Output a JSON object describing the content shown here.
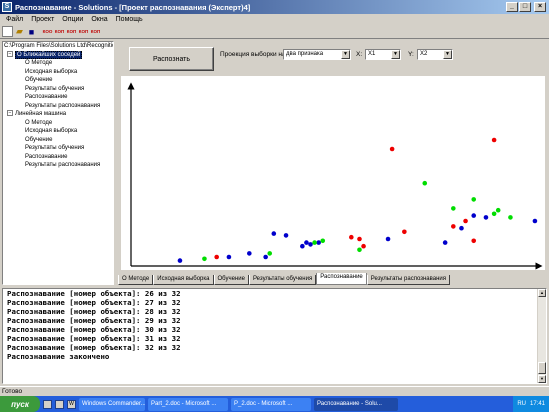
{
  "window": {
    "title": "Распознавание - Solutions - [Проект распознавания (Эксперт)4]"
  },
  "menu": [
    "Файл",
    "Проект",
    "Опции",
    "Окна",
    "Помощь"
  ],
  "toolbar": {
    "labels": [
      "КОО",
      "КОП",
      "КОП",
      "КОП",
      "КОП"
    ]
  },
  "tree": {
    "rows": [
      {
        "label": "C:\\Program Files\\Solutions Ltd\\Recognitior",
        "level": 0,
        "box": ""
      },
      {
        "label": "О Ближайших соседей",
        "level": 1,
        "box": "−",
        "selected": true
      },
      {
        "label": "О Методе",
        "level": 2,
        "box": ""
      },
      {
        "label": "Исходная выборка",
        "level": 2,
        "box": ""
      },
      {
        "label": "Обучение",
        "level": 2,
        "box": ""
      },
      {
        "label": "Результаты обучения",
        "level": 2,
        "box": ""
      },
      {
        "label": "Распознавание",
        "level": 2,
        "box": ""
      },
      {
        "label": "Результаты распознавания",
        "level": 2,
        "box": ""
      },
      {
        "label": "Линейная машина",
        "level": 1,
        "box": "−"
      },
      {
        "label": "О Методе",
        "level": 2,
        "box": ""
      },
      {
        "label": "Исходная выборка",
        "level": 2,
        "box": ""
      },
      {
        "label": "Обучение",
        "level": 2,
        "box": ""
      },
      {
        "label": "Результаты обучения",
        "level": 2,
        "box": ""
      },
      {
        "label": "Распознавание",
        "level": 2,
        "box": ""
      },
      {
        "label": "Результаты распознавания",
        "level": 2,
        "box": ""
      }
    ]
  },
  "panel": {
    "recognize_button": "Распознать",
    "projection_label": "Проекция выборки на:",
    "projection_value": "два признака",
    "x_label": "X:",
    "x_value": "X1",
    "y_label": "Y:",
    "y_value": "X2"
  },
  "chart_data": {
    "type": "scatter",
    "title": "",
    "xlabel": "",
    "ylabel": "",
    "xlim": [
      0,
      100
    ],
    "ylim": [
      0,
      100
    ],
    "grid": false,
    "series": [
      {
        "color": "#0000cc",
        "points": [
          [
            12,
            3
          ],
          [
            24,
            5
          ],
          [
            29,
            7
          ],
          [
            33,
            5
          ],
          [
            35,
            18
          ],
          [
            38,
            17
          ],
          [
            42,
            11
          ],
          [
            43,
            13
          ],
          [
            44,
            12
          ],
          [
            46,
            13
          ],
          [
            63,
            15
          ],
          [
            77,
            13
          ],
          [
            81,
            21
          ],
          [
            84,
            28
          ],
          [
            87,
            27
          ],
          [
            99,
            25
          ]
        ]
      },
      {
        "color": "#ee0000",
        "points": [
          [
            21,
            5
          ],
          [
            54,
            16
          ],
          [
            56,
            15
          ],
          [
            57,
            11
          ],
          [
            64,
            65
          ],
          [
            67,
            19
          ],
          [
            79,
            22
          ],
          [
            82,
            25
          ],
          [
            84,
            14
          ],
          [
            89,
            70
          ]
        ]
      },
      {
        "color": "#00dd00",
        "points": [
          [
            18,
            4
          ],
          [
            34,
            7
          ],
          [
            45,
            13
          ],
          [
            47,
            14
          ],
          [
            56,
            9
          ],
          [
            72,
            46
          ],
          [
            79,
            32
          ],
          [
            84,
            37
          ],
          [
            89,
            29
          ],
          [
            90,
            31
          ],
          [
            93,
            27
          ]
        ]
      }
    ]
  },
  "tabs": [
    {
      "label": "О Методе",
      "active": false
    },
    {
      "label": "Исходная выборка",
      "active": false
    },
    {
      "label": "Обучение",
      "active": false
    },
    {
      "label": "Результаты обучения",
      "active": false
    },
    {
      "label": "Распознавание",
      "active": true
    },
    {
      "label": "Результаты распознавания",
      "active": false
    }
  ],
  "log": [
    "Распознавание [номер объекта]: 26 из 32",
    "Распознавание [номер объекта]: 27 из 32",
    "Распознавание [номер объекта]: 28 из 32",
    "Распознавание [номер объекта]: 29 из 32",
    "Распознавание [номер объекта]: 30 из 32",
    "Распознавание [номер объекта]: 31 из 32",
    "Распознавание [номер объекта]: 32 из 32",
    "Распознавание закончено"
  ],
  "status": "Готово",
  "taskbar": {
    "start": "пуск",
    "tasks": [
      {
        "label": "Windows Commander...",
        "active": false
      },
      {
        "label": "Part_2.doc - Microsoft ...",
        "active": false
      },
      {
        "label": "P_2.doc - Microsoft ...",
        "active": false
      },
      {
        "label": "Распознавание - Solu...",
        "active": true
      }
    ],
    "lang": "RU",
    "clock": "17:41"
  }
}
